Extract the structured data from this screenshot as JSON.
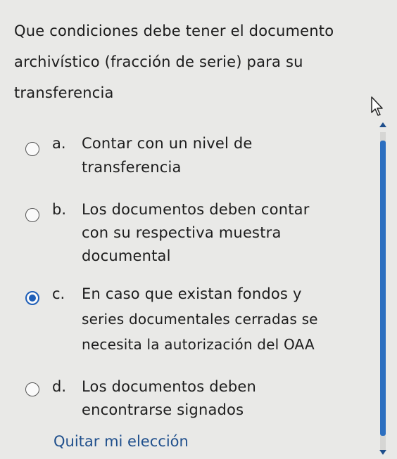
{
  "question": {
    "lines": [
      "Que condiciones debe tener el documento",
      "archivístico (fracción de serie) para su",
      "transferencia"
    ]
  },
  "options": [
    {
      "letter": "a.",
      "lines": [
        "Contar con un nivel de",
        "transferencia"
      ],
      "selected": false
    },
    {
      "letter": "b.",
      "lines": [
        "Los documentos deben contar",
        "con su respectiva muestra",
        "documental"
      ],
      "selected": false
    },
    {
      "letter": "c.",
      "lines": [
        "En caso que existan fondos y",
        "series documentales cerradas se",
        "necesita la autorización del OAA"
      ],
      "selected": true
    },
    {
      "letter": "d.",
      "lines": [
        "Los documentos deben",
        "encontrarse signados"
      ],
      "selected": false
    }
  ],
  "clear_choice": "Quitar mi elección",
  "colors": {
    "accent": "#1f5fb8",
    "link": "#1f4f8c",
    "background": "#e9e9e7"
  },
  "icons": {
    "cursor": "mouse-pointer-icon"
  }
}
